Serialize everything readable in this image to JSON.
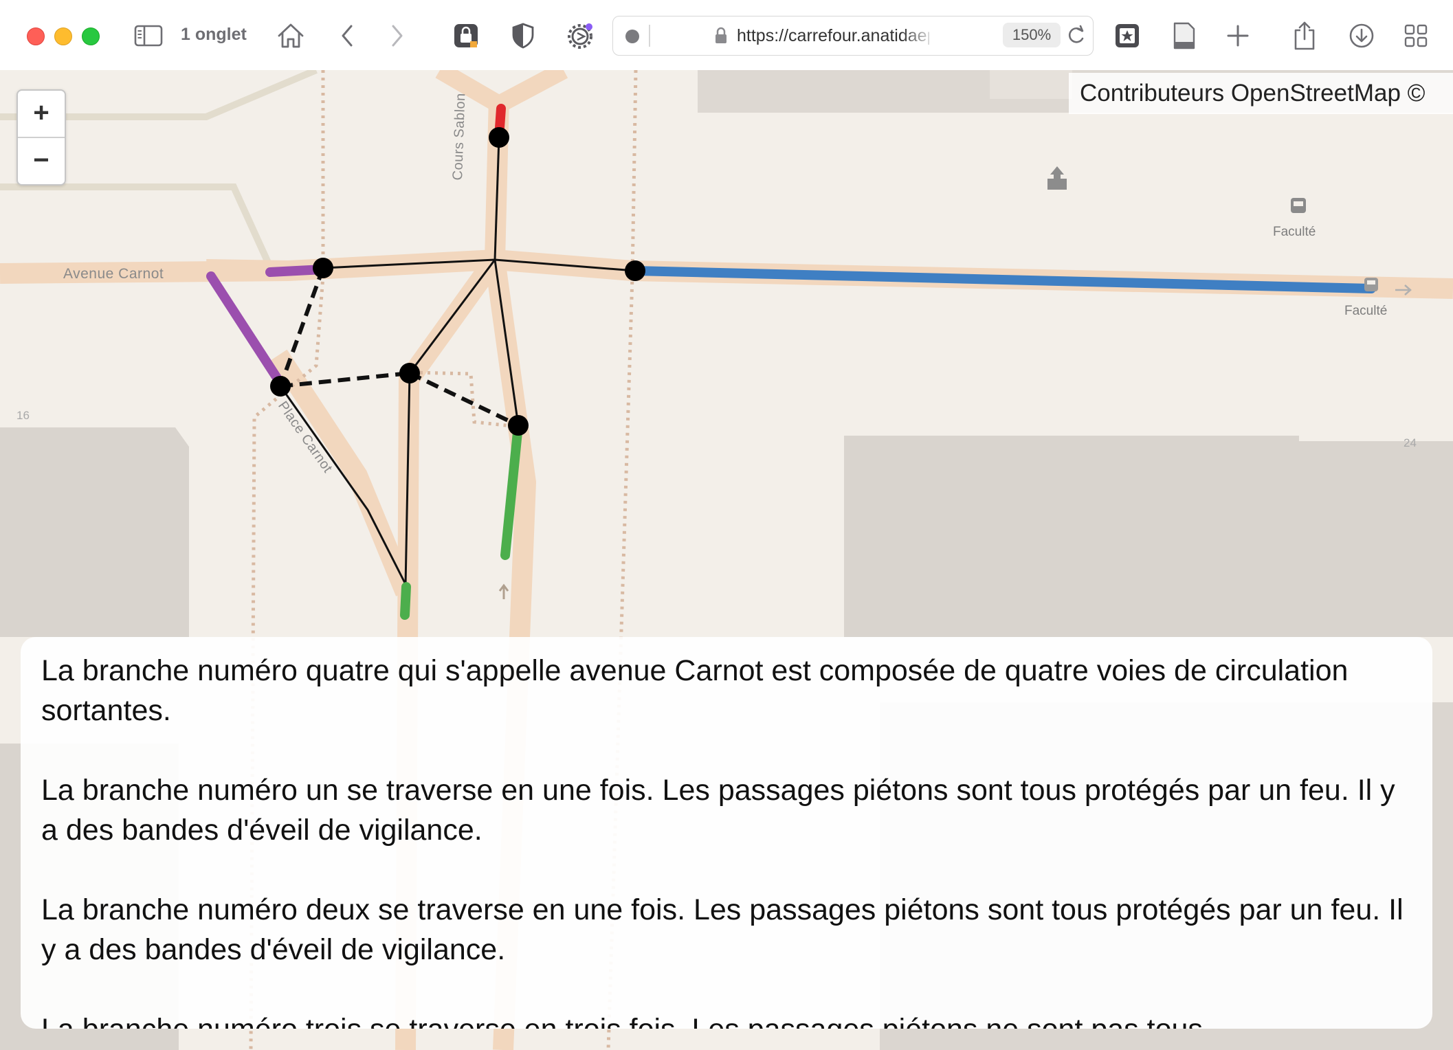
{
  "browser": {
    "tab_count": "1 onglet",
    "url": "https://carrefour.anatidaepho.be",
    "zoom": "150%"
  },
  "map": {
    "attribution": "Contributeurs OpenStreetMap ©",
    "zoom_in": "+",
    "zoom_out": "−",
    "labels": {
      "avenue_carnot": "Avenue Carnot",
      "cours_sablon": "Cours Sablon",
      "place_carnot": "Place Carnot",
      "faculte_1": "Faculté",
      "faculte_2": "Faculté",
      "hn_16": "16",
      "hn_24": "24"
    },
    "colors": {
      "branch_1": "#e0282c",
      "branch_2": "#3f7fc3",
      "branch_3": "#4cae4c",
      "branch_4": "#9b4fae",
      "road_casing": "#f2d7be",
      "building": "#d9d3cd"
    }
  },
  "description": {
    "paragraphs": [
      "La branche numéro quatre qui s'appelle avenue Carnot est composée de quatre voies de circulation sortantes.",
      "La branche numéro un se traverse en une fois. Les passages piétons sont tous protégés par un feu. Il y a des bandes d'éveil de vigilance.",
      "La branche numéro deux se traverse en une fois. Les passages piétons sont tous protégés par un feu. Il y a des bandes d'éveil de vigilance.",
      "La branche numéro trois se traverse en trois fois. Les passages piétons ne sont pas tous"
    ]
  }
}
